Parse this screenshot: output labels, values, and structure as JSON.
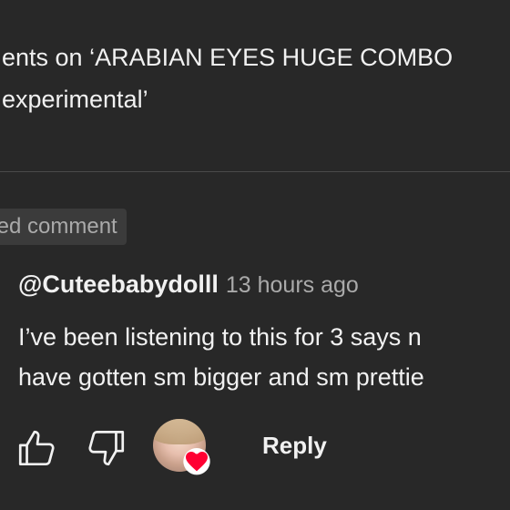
{
  "header": {
    "title_line1": "ents on ‘ARABIAN EYES HUGE COMBO",
    "title_line2": "experimental’"
  },
  "highlighted_label": "ted comment",
  "comment": {
    "author": "@Cuteebabydolll",
    "timestamp": "13 hours ago",
    "text_line1": "I’ve been listening to this for 3 says n",
    "text_line2": "have gotten sm bigger and sm prettie"
  },
  "actions": {
    "like_icon": "thumb-up-icon",
    "dislike_icon": "thumb-down-icon",
    "creator_heart_icon": "heart-icon",
    "reply_label": "Reply"
  },
  "colors": {
    "background": "#282828",
    "text_primary": "#f1f1f1",
    "text_secondary": "#aaaaaa",
    "heart": "#ff0033"
  }
}
